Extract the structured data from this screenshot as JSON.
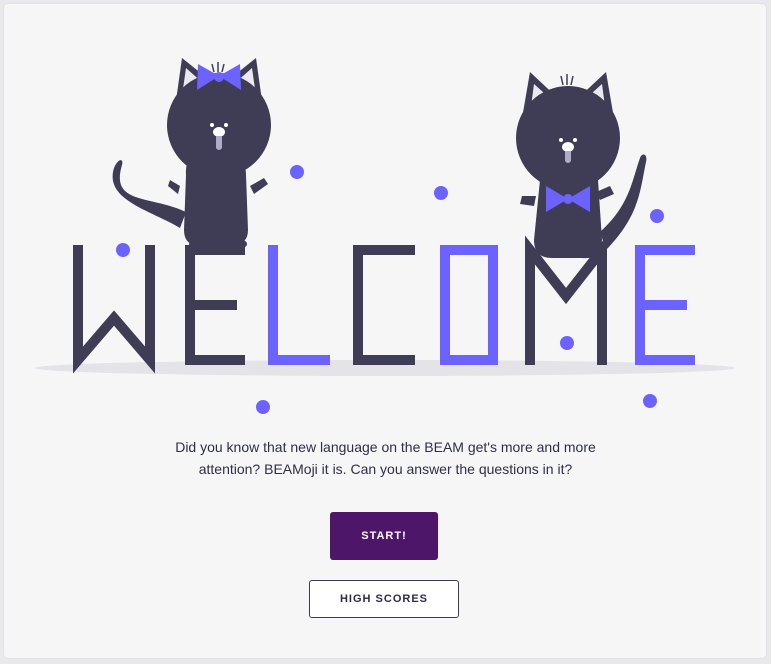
{
  "hero": {
    "heading": "WELCOME",
    "image_name": "welcome-cats-illustration"
  },
  "intro": {
    "line1": "Did you know that new language on the BEAM get's more and more",
    "line2": "attention? BEAMoji it is. Can you answer the questions in it?"
  },
  "actions": {
    "start_label": "START!",
    "high_scores_label": "HIGH SCORES"
  },
  "colors": {
    "accent": "#6c63ff",
    "dark": "#3f3d56",
    "start_button": "#4d1668",
    "background": "#f6f6f7"
  }
}
